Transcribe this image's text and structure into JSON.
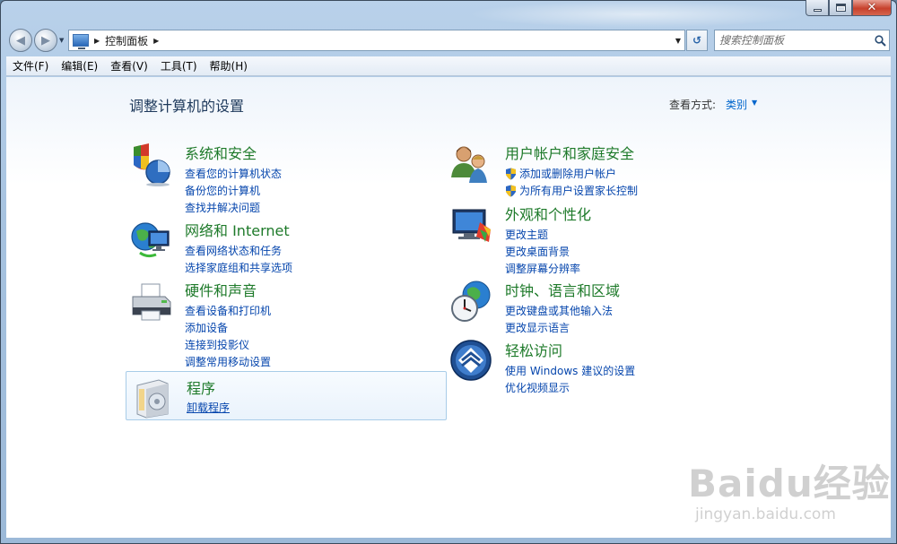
{
  "navigation": {
    "breadcrumb": "控制面板",
    "search_placeholder": "搜索控制面板"
  },
  "menubar": {
    "items": [
      "文件(F)",
      "编辑(E)",
      "查看(V)",
      "工具(T)",
      "帮助(H)"
    ]
  },
  "page": {
    "title": "调整计算机的设置",
    "view_by_label": "查看方式:",
    "view_by_value": "类别"
  },
  "categories": {
    "system": {
      "title": "系统和安全",
      "icon": "shield-chart-icon",
      "links": [
        "查看您的计算机状态",
        "备份您的计算机",
        "查找并解决问题"
      ]
    },
    "network": {
      "title": "网络和 Internet",
      "icon": "globe-network-icon",
      "links": [
        "查看网络状态和任务",
        "选择家庭组和共享选项"
      ]
    },
    "hardware": {
      "title": "硬件和声音",
      "icon": "printer-icon",
      "links": [
        "查看设备和打印机",
        "添加设备",
        "连接到投影仪",
        "调整常用移动设置"
      ]
    },
    "programs": {
      "title": "程序",
      "icon": "programs-box-icon",
      "links": [
        "卸载程序"
      ]
    },
    "users": {
      "title": "用户帐户和家庭安全",
      "icon": "users-icon",
      "links": [
        "添加或删除用户帐户",
        "为所有用户设置家长控制"
      ]
    },
    "appearance": {
      "title": "外观和个性化",
      "icon": "monitor-paint-icon",
      "links": [
        "更改主题",
        "更改桌面背景",
        "调整屏幕分辨率"
      ]
    },
    "clock": {
      "title": "时钟、语言和区域",
      "icon": "clock-globe-icon",
      "links": [
        "更改键盘或其他输入法",
        "更改显示语言"
      ]
    },
    "ease": {
      "title": "轻松访问",
      "icon": "ease-of-access-icon",
      "links": [
        "使用 Windows 建议的设置",
        "优化视频显示"
      ]
    }
  },
  "watermark": {
    "line1": "Baidu经验",
    "line2": "jingyan.baidu.com"
  }
}
